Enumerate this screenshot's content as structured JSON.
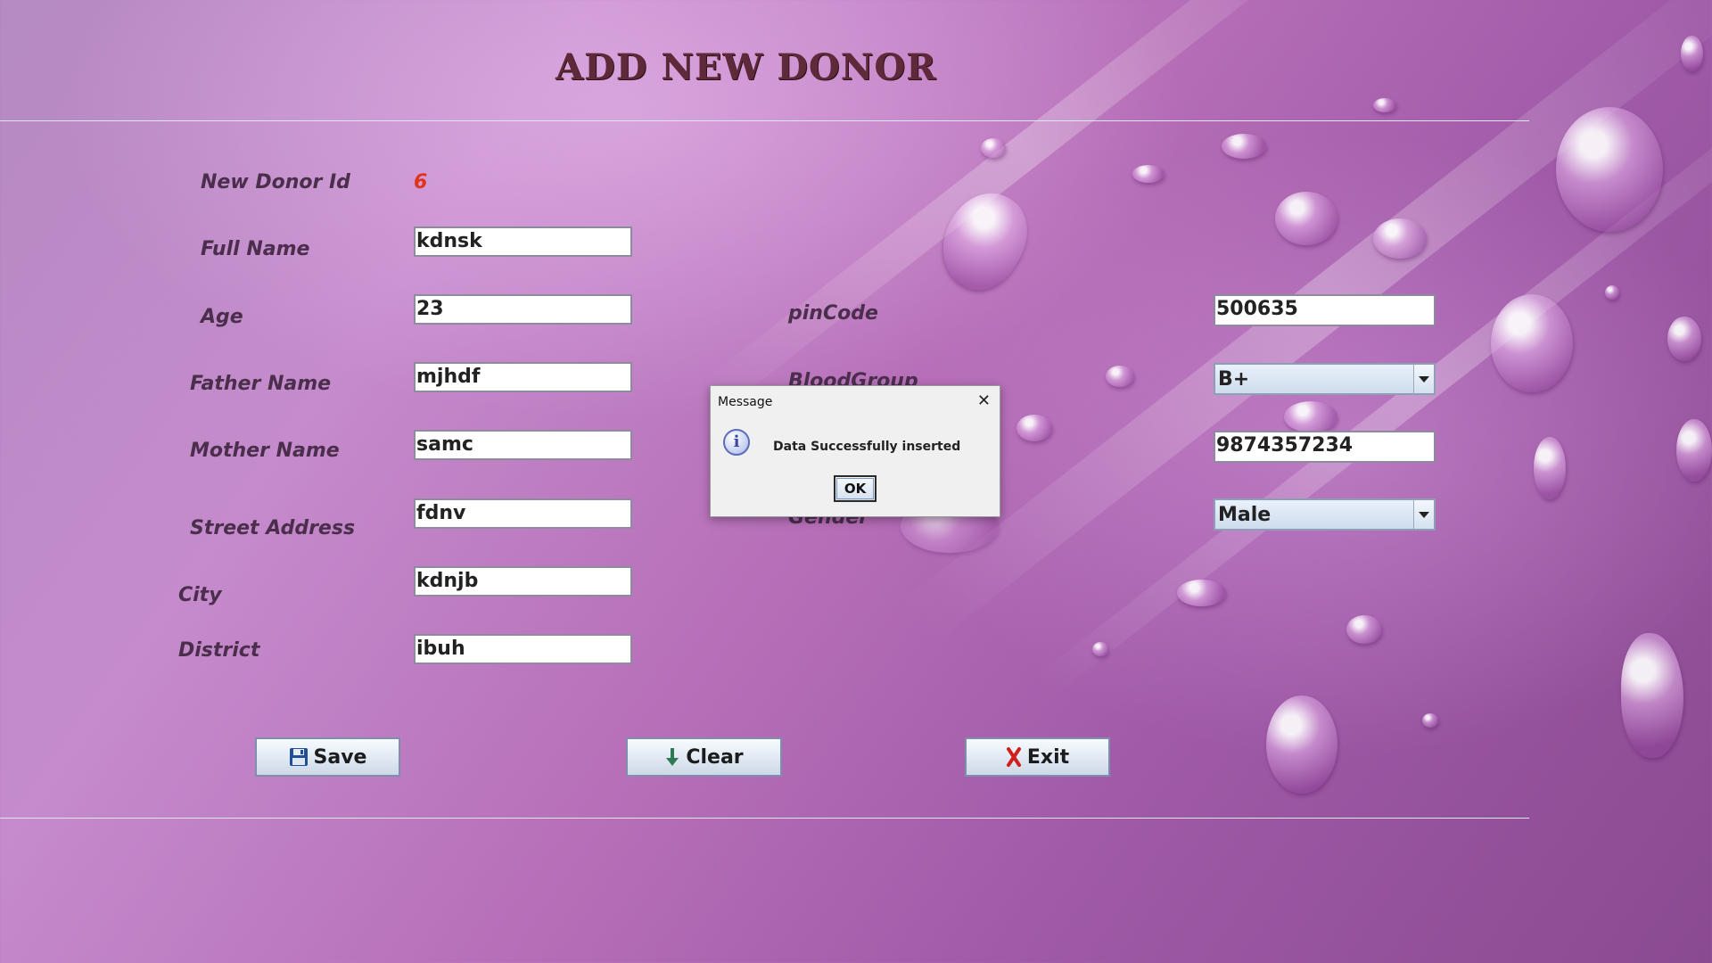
{
  "header": {
    "title": "ADD NEW DONOR"
  },
  "form": {
    "donor_id_label": "New Donor Id",
    "donor_id_value": "6",
    "full_name": {
      "label": "Full Name",
      "value": "kdnsk"
    },
    "age": {
      "label": "Age",
      "value": "23"
    },
    "father_name": {
      "label": "Father Name",
      "value": "mjhdf"
    },
    "mother_name": {
      "label": "Mother Name",
      "value": "samc"
    },
    "street_address": {
      "label": "Street Address",
      "value": "fdnv"
    },
    "city": {
      "label": "City",
      "value": "kdnjb"
    },
    "district": {
      "label": "District",
      "value": "ibuh"
    },
    "pincode": {
      "label": "pinCode",
      "value": "500635"
    },
    "blood_group": {
      "label": "BloodGroup",
      "value": "B+"
    },
    "mobile": {
      "value": "9874357234"
    },
    "gender": {
      "label": "Gender",
      "value": "Male"
    }
  },
  "buttons": {
    "save": "Save",
    "clear": "Clear",
    "exit": "Exit"
  },
  "dialog": {
    "title": "Message",
    "message": "Data Successfully inserted",
    "ok_label": "OK"
  },
  "colors": {
    "donor_id": "#e0331a",
    "accent_line": "#dbe7f2",
    "title": "#5e2a3a"
  },
  "icons": {
    "save": "floppy-disk-icon",
    "clear": "down-arrow-icon",
    "exit": "red-x-icon",
    "dialog": "information-icon",
    "dialog_close": "close-icon"
  }
}
